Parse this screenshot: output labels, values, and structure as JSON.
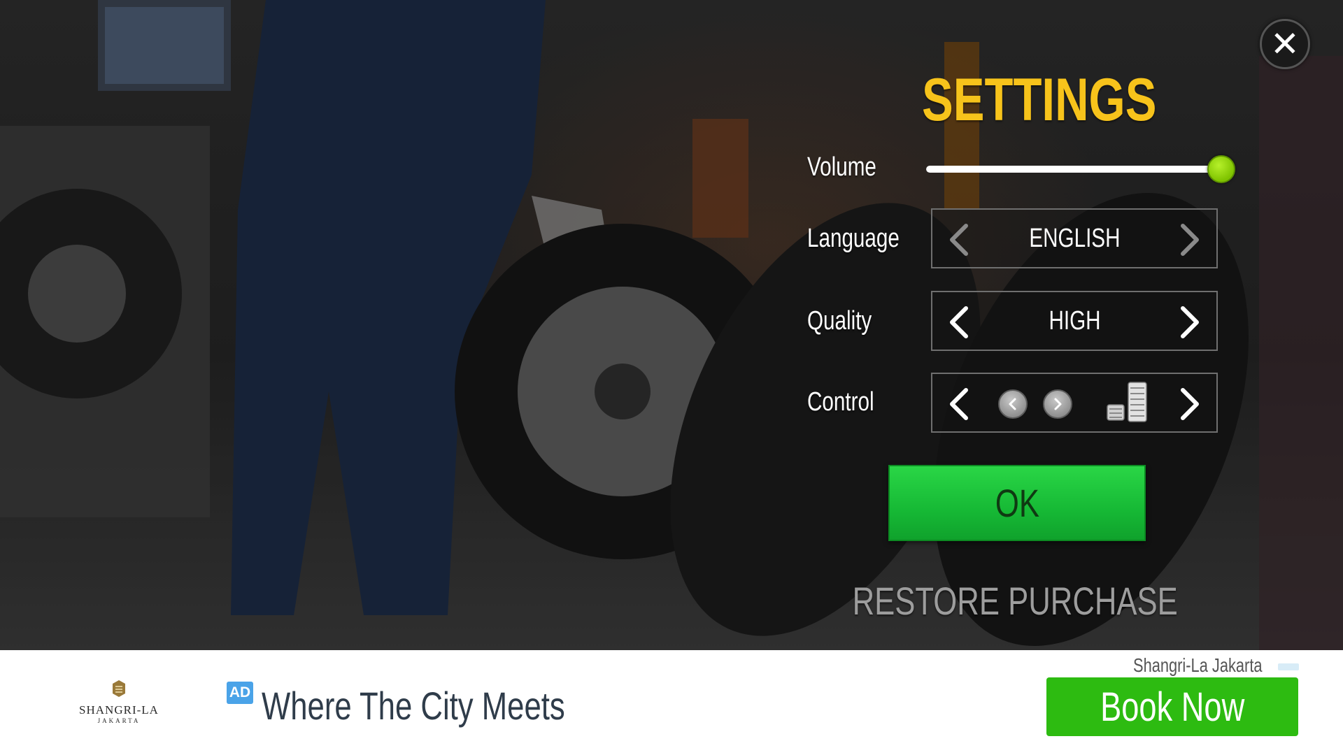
{
  "settings": {
    "title": "SETTINGS",
    "volume": {
      "label": "Volume",
      "level": 1.0
    },
    "language": {
      "label": "Language",
      "value": "ENGLISH"
    },
    "quality": {
      "label": "Quality",
      "value": "HIGH"
    },
    "control": {
      "label": "Control",
      "value_icons": [
        "left-arrow-button-icon",
        "right-arrow-button-icon",
        "pedals-icon"
      ]
    },
    "ok_label": "OK",
    "restore_label": "RESTORE PURCHASE"
  },
  "close_button": {
    "icon": "close-icon",
    "glyph": "✕"
  },
  "ad": {
    "logo_name": "SHANGRI-LA",
    "logo_sub": "JAKARTA",
    "badge": "AD",
    "headline": "Where The City Meets",
    "advertiser": "Shangri-La Jakarta",
    "cta_label": "Book Now"
  },
  "colors": {
    "title": "#f7c31b",
    "ok_button": "#16b935",
    "slider_thumb": "#7fc300",
    "cta_button": "#2dbb11",
    "ad_badge": "#4aa3e8"
  }
}
